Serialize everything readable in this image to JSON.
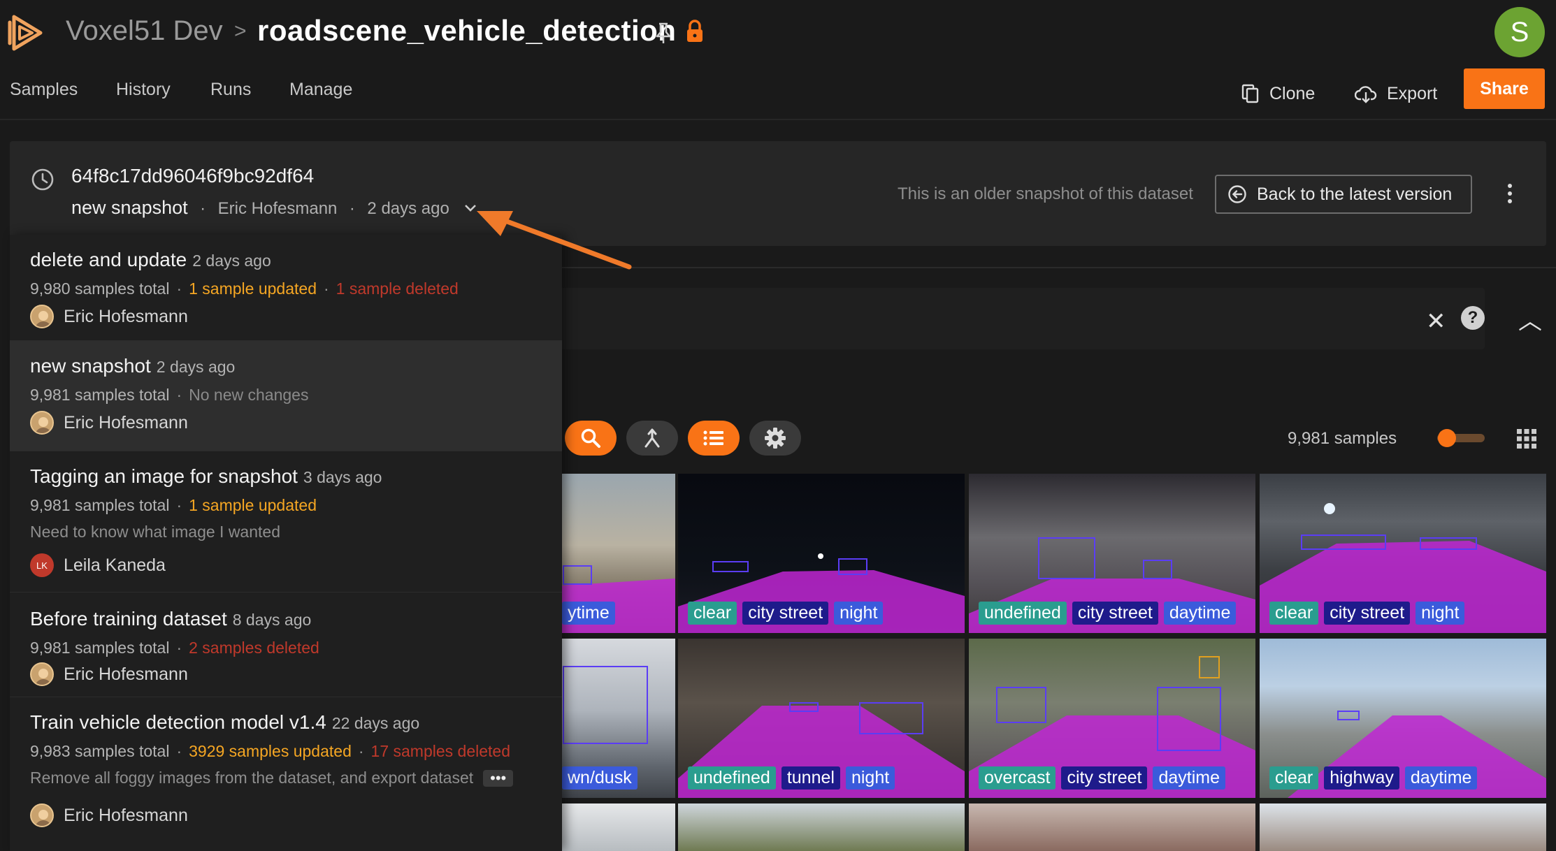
{
  "header": {
    "org": "Voxel51 Dev",
    "separator": ">",
    "dataset": "roadscene_vehicle_detection",
    "avatar_letter": "S"
  },
  "nav": {
    "tabs": [
      "Samples",
      "History",
      "Runs",
      "Manage"
    ],
    "clone_label": "Clone",
    "export_label": "Export",
    "share_label": "Share"
  },
  "banner": {
    "snapshot_id": "64f8c17dd96046f9bc92df64",
    "snapshot_name": "new snapshot",
    "author": "Eric Hofesmann",
    "ago": "2 days ago",
    "older_message": "This is an older snapshot of this dataset",
    "back_label": "Back to the latest version"
  },
  "toolbar": {
    "samples_count": "9,981 samples"
  },
  "snapshots": [
    {
      "title": "delete and update",
      "ago": "2 days ago",
      "total": "9,980 samples total",
      "updated": "1 sample updated",
      "deleted": "1 sample deleted",
      "author": "Eric Hofesmann"
    },
    {
      "title": "new snapshot",
      "ago": "2 days ago",
      "total": "9,981 samples total",
      "none": "No new changes",
      "author": "Eric Hofesmann"
    },
    {
      "title": "Tagging an image for snapshot",
      "ago": "3 days ago",
      "total": "9,981 samples total",
      "updated": "1 sample updated",
      "description": "Need to know what image I wanted",
      "author": "Leila Kaneda",
      "initials": "LK"
    },
    {
      "title": "Before training dataset",
      "ago": "8 days ago",
      "total": "9,981 samples total",
      "deleted": "2 samples deleted",
      "author": "Eric Hofesmann"
    },
    {
      "title": "Train vehicle detection model v1.4",
      "ago": "22 days ago",
      "total": "9,983 samples total",
      "updated": "3929 samples updated",
      "deleted": "17 samples deleted",
      "description": "Remove all foggy images from the dataset, and export dataset",
      "more": "•••",
      "author": "Eric Hofesmann"
    }
  ],
  "tiles": [
    {
      "tags": [
        "ytime"
      ]
    },
    {
      "tags": [
        "clear",
        "city street",
        "night"
      ]
    },
    {
      "tags": [
        "undefined",
        "city street",
        "daytime"
      ]
    },
    {
      "tags": [
        "clear",
        "city street",
        "night"
      ]
    },
    {
      "tags": [
        "wn/dusk"
      ]
    },
    {
      "tags": [
        "undefined",
        "tunnel",
        "night"
      ]
    },
    {
      "tags": [
        "overcast",
        "city street",
        "daytime"
      ]
    },
    {
      "tags": [
        "clear",
        "highway",
        "daytime"
      ]
    }
  ],
  "colors": {
    "accent": "#f97316",
    "updated": "#f5a623",
    "deleted": "#c0392b",
    "segmentation": "#c026d3",
    "tag_weather": "#2a9d8f",
    "tag_scene": "#1e1b8b",
    "tag_time": "#3b5bdb"
  }
}
